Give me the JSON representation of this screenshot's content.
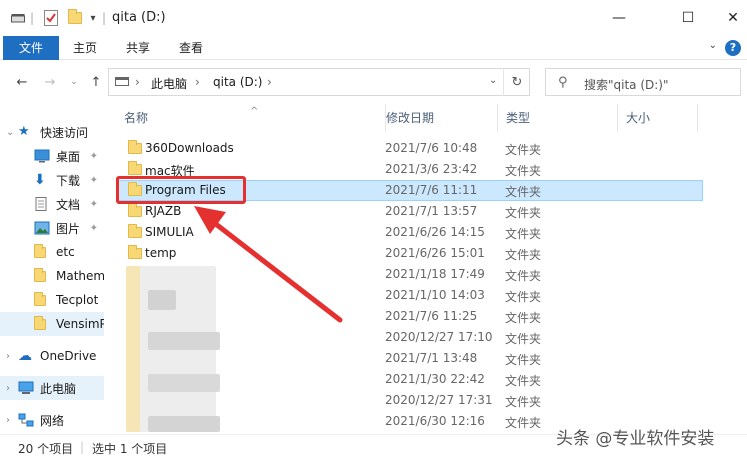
{
  "window": {
    "title": "qita (D:)",
    "minimize_glyph": "—",
    "maximize_glyph": "☐",
    "close_glyph": "✕"
  },
  "ribbon": {
    "tabs": [
      {
        "label": "文件",
        "active": true
      },
      {
        "label": "主页",
        "active": false
      },
      {
        "label": "共享",
        "active": false
      },
      {
        "label": "查看",
        "active": false
      }
    ],
    "help": "?"
  },
  "address": {
    "segments": [
      "此电脑",
      "qita (D:)"
    ],
    "separator": "›"
  },
  "search": {
    "placeholder": "搜索\"qita (D:)\""
  },
  "sidebar": {
    "items": [
      {
        "label": "快速访问",
        "icon": "star-icon",
        "pinned": false
      },
      {
        "label": "桌面",
        "icon": "desktop-icon",
        "pinned": true
      },
      {
        "label": "下载",
        "icon": "download-icon",
        "pinned": true
      },
      {
        "label": "文档",
        "icon": "document-icon",
        "pinned": true
      },
      {
        "label": "图片",
        "icon": "picture-icon",
        "pinned": true
      },
      {
        "label": "etc",
        "icon": "folder-icon",
        "pinned": false
      },
      {
        "label": "Mathem",
        "icon": "folder-icon",
        "pinned": false
      },
      {
        "label": "Tecplot",
        "icon": "folder-icon",
        "pinned": false
      },
      {
        "label": "VensimP",
        "icon": "folder-icon",
        "pinned": false
      },
      {
        "label": "OneDrive",
        "icon": "cloud-icon",
        "pinned": false
      },
      {
        "label": "此电脑",
        "icon": "computer-icon",
        "pinned": false
      },
      {
        "label": "网络",
        "icon": "network-icon",
        "pinned": false
      }
    ]
  },
  "columns": {
    "name": "名称",
    "date": "修改日期",
    "type": "类型",
    "size": "大小"
  },
  "files": [
    {
      "name": "360Downloads",
      "date": "2021/7/6 10:48",
      "type": "文件夹",
      "selected": false
    },
    {
      "name": "mac软件",
      "date": "2021/3/6 23:42",
      "type": "文件夹",
      "selected": false
    },
    {
      "name": "Program Files",
      "date": "2021/7/6 11:11",
      "type": "文件夹",
      "selected": true
    },
    {
      "name": "RJAZB",
      "date": "2021/7/1 13:57",
      "type": "文件夹",
      "selected": false
    },
    {
      "name": "SIMULIA",
      "date": "2021/6/26 14:15",
      "type": "文件夹",
      "selected": false
    },
    {
      "name": "temp",
      "date": "2021/6/26 15:01",
      "type": "文件夹",
      "selected": false
    },
    {
      "name": "",
      "date": "2021/1/18 17:49",
      "type": "文件夹",
      "selected": false
    },
    {
      "name": "",
      "date": "2021/1/10 14:03",
      "type": "文件夹",
      "selected": false
    },
    {
      "name": "",
      "date": "2021/7/6 11:25",
      "type": "文件夹",
      "selected": false
    },
    {
      "name": "",
      "date": "2020/12/27 17:10",
      "type": "文件夹",
      "selected": false
    },
    {
      "name": "",
      "date": "2021/7/1 13:48",
      "type": "文件夹",
      "selected": false
    },
    {
      "name": "",
      "date": "2021/1/30 22:42",
      "type": "文件夹",
      "selected": false
    },
    {
      "name": "",
      "date": "2020/12/27 17:31",
      "type": "文件夹",
      "selected": false
    },
    {
      "name": "",
      "date": "2021/6/30 12:16",
      "type": "文件夹",
      "selected": false
    }
  ],
  "status": {
    "count": "20 个项目",
    "selection": "选中 1 个项目"
  },
  "watermark": "头条 @专业软件安装",
  "colors": {
    "accent": "#1e6fc1",
    "selection": "#cce8ff",
    "highlight": "#e53030"
  }
}
